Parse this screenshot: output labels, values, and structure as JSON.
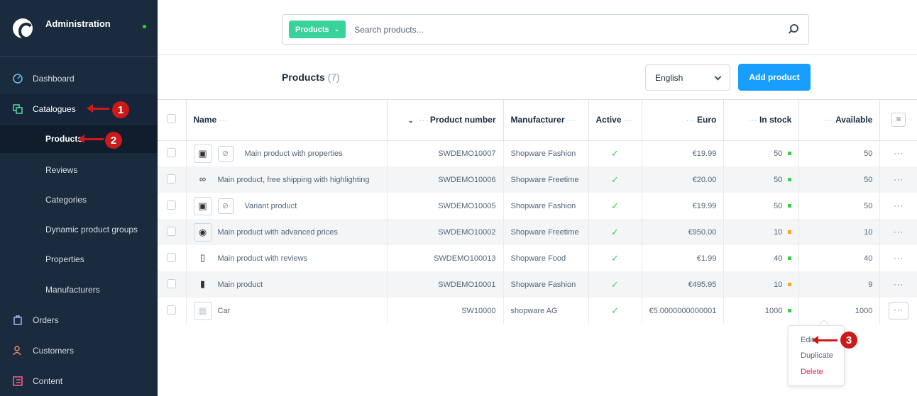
{
  "app": {
    "title": "Administration"
  },
  "sidebar": {
    "items": [
      {
        "label": "Dashboard",
        "icon": "gauge-icon"
      },
      {
        "label": "Catalogues",
        "icon": "catalogue-icon"
      },
      {
        "label": "Products"
      },
      {
        "label": "Reviews"
      },
      {
        "label": "Categories"
      },
      {
        "label": "Dynamic product groups"
      },
      {
        "label": "Properties"
      },
      {
        "label": "Manufacturers"
      },
      {
        "label": "Orders",
        "icon": "bag-icon"
      },
      {
        "label": "Customers",
        "icon": "users-icon"
      },
      {
        "label": "Content",
        "icon": "content-icon"
      }
    ]
  },
  "annotations": {
    "one": "1",
    "two": "2",
    "three": "3"
  },
  "search": {
    "type_label": "Products",
    "placeholder": "Search products..."
  },
  "header": {
    "title": "Products",
    "count": "(7)",
    "language": "English",
    "add_label": "Add product"
  },
  "table": {
    "columns": [
      "Name",
      "Product number",
      "Manufacturer",
      "Active",
      "Euro",
      "In stock",
      "Available"
    ],
    "rows": [
      {
        "name": "Main product with properties",
        "number": "SWDEMO10007",
        "manufacturer": "Shopware Fashion",
        "active": "✓",
        "price": "€19.99",
        "stock": "50",
        "available": "50"
      },
      {
        "name": "Main product, free shipping with highlighting",
        "number": "SWDEMO10006",
        "manufacturer": "Shopware Freetime",
        "active": "✓",
        "price": "€20.00",
        "stock": "50",
        "available": "50"
      },
      {
        "name": "Variant product",
        "number": "SWDEMO10005",
        "manufacturer": "Shopware Fashion",
        "active": "✓",
        "price": "€19.99",
        "stock": "50",
        "available": "50"
      },
      {
        "name": "Main product with advanced prices",
        "number": "SWDEMO10002",
        "manufacturer": "Shopware Freetime",
        "active": "✓",
        "price": "€950.00",
        "stock": "10",
        "available": "10"
      },
      {
        "name": "Main product with reviews",
        "number": "SWDEMO100013",
        "manufacturer": "Shopware Food",
        "active": "✓",
        "price": "€1.99",
        "stock": "40",
        "available": "40"
      },
      {
        "name": "Main product",
        "number": "SWDEMO10001",
        "manufacturer": "Shopware Fashion",
        "active": "✓",
        "price": "€495.95",
        "stock": "10",
        "available": "9"
      },
      {
        "name": "Car",
        "number": "SW10000",
        "manufacturer": "shopware AG",
        "active": "✓",
        "price": "€5.0000000000001",
        "stock": "1000",
        "available": "1000"
      }
    ]
  },
  "context_menu": {
    "edit": "Edit",
    "duplicate": "Duplicate",
    "delete": "Delete"
  },
  "colors": {
    "sidebar": "#1a2b3d",
    "accent": "#189eff",
    "search_type": "#37d39a",
    "stock_ok": "#37d046",
    "stock_low": "#f6a623",
    "delete": "#de294c",
    "annotation": "#cc1a1a"
  }
}
